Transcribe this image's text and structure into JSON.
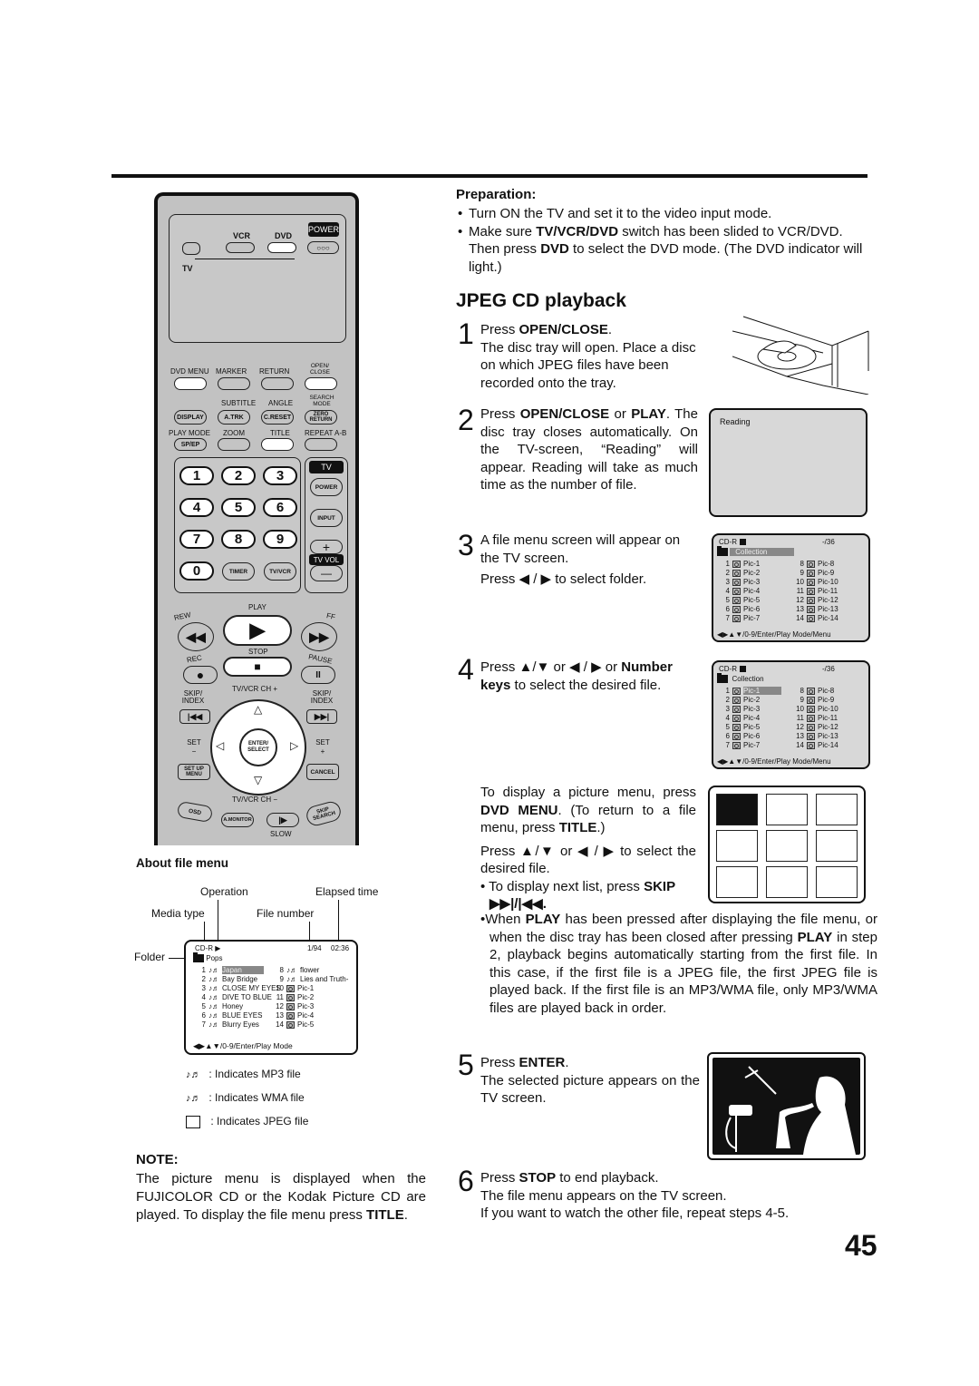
{
  "remote": {
    "vcr": "VCR",
    "dvd": "DVD",
    "power": "POWER",
    "tv_switch": "TV",
    "row1": [
      "DVD MENU",
      "MARKER",
      "RETURN",
      "OPEN/ CLOSE"
    ],
    "row2_labels": [
      "SUBTITLE",
      "ANGLE",
      "SEARCH MODE"
    ],
    "row2_buttons": [
      "DISPLAY",
      "A.TRK",
      "C.RESET",
      "ZERO RETURN"
    ],
    "row3_labels": [
      "PLAY MODE",
      "ZOOM",
      "TITLE",
      "REPEAT A-B"
    ],
    "row3_buttons": [
      "SP/EP"
    ],
    "numbers": [
      "1",
      "2",
      "3",
      "4",
      "5",
      "6",
      "7",
      "8",
      "9",
      "0"
    ],
    "timer": "TIMER",
    "tvvcr": "TV/VCR",
    "tv_badge": "TV",
    "tv_power": "POWER",
    "input": "INPUT",
    "vol_plus": "+",
    "vol_label": "TV VOL",
    "vol_minus": "—",
    "play": "PLAY",
    "rew": "REW",
    "ff": "FF",
    "rec": "REC",
    "stop": "STOP",
    "pause": "PAUSE",
    "ch_plus": "TV/VCR CH +",
    "ch_minus": "TV/VCR CH −",
    "skip_index_l": "SKIP/ INDEX",
    "skip_index_r": "SKIP/ INDEX",
    "set_minus": "SET −",
    "set_plus": "SET +",
    "enter": "ENTER/ SELECT",
    "setup_menu": "SET UP MENU",
    "cancel": "CANCEL",
    "osd": "OSD",
    "amonitor": "A.MONITOR",
    "skip_search": "SKIP SEARCH",
    "slow": "SLOW"
  },
  "about": {
    "heading": "About file menu",
    "labels": {
      "operation": "Operation",
      "elapsed": "Elapsed time",
      "media_type": "Media type",
      "file_number": "File number",
      "folder": "Folder"
    },
    "screen": {
      "media": "CD-R",
      "op": "▶",
      "file_no": "1/94",
      "time": "02:36",
      "folder": "Pops",
      "left": [
        {
          "n": "1",
          "name": "Japan",
          "type": "mp3",
          "selected": true
        },
        {
          "n": "2",
          "name": "Bay Bridge",
          "type": "mp3"
        },
        {
          "n": "3",
          "name": "CLOSE MY EYES",
          "type": "mp3"
        },
        {
          "n": "4",
          "name": "DIVE TO BLUE",
          "type": "mp3"
        },
        {
          "n": "5",
          "name": "Honey",
          "type": "mp3"
        },
        {
          "n": "6",
          "name": "BLUE EYES",
          "type": "mp3"
        },
        {
          "n": "7",
          "name": "Blurry Eyes",
          "type": "mp3"
        }
      ],
      "right": [
        {
          "n": "8",
          "name": "flower",
          "type": "mp3"
        },
        {
          "n": "9",
          "name": "Lies and Truth-",
          "type": "mp3"
        },
        {
          "n": "10",
          "name": "Pic-1",
          "type": "jpeg"
        },
        {
          "n": "11",
          "name": "Pic-2",
          "type": "jpeg"
        },
        {
          "n": "12",
          "name": "Pic-3",
          "type": "jpeg"
        },
        {
          "n": "13",
          "name": "Pic-4",
          "type": "jpeg"
        },
        {
          "n": "14",
          "name": "Pic-5",
          "type": "jpeg"
        }
      ],
      "footer": "◀▶▲▼/0-9/Enter/Play Mode"
    },
    "legend": [
      {
        "icon": "mp3-icon",
        "text": ": Indicates MP3 file"
      },
      {
        "icon": "wma-icon",
        "text": ": Indicates WMA file"
      },
      {
        "icon": "jpeg-icon",
        "text": ": Indicates JPEG file"
      }
    ]
  },
  "note": {
    "heading": "NOTE:",
    "text_a": "The picture menu is displayed when the FUJICOLOR CD or the Kodak Picture CD are played. To display the file menu press ",
    "text_b": "TITLE",
    "text_c": "."
  },
  "preparation": {
    "heading": "Preparation:",
    "b1": "Turn ON the TV and set it to the video input mode.",
    "b2_a": "Make sure ",
    "b2_b": "TV/VCR/DVD",
    "b2_c": " switch has been slided to VCR/DVD. Then press ",
    "b2_d": "DVD",
    "b2_e": " to select the DVD mode. (The DVD indicator will light.)"
  },
  "section_title": "JPEG CD playback",
  "steps": [
    {
      "num": "1",
      "l1a": "Press ",
      "l1b": "OPEN/CLOSE",
      "l1c": ".",
      "rest": "The disc tray will open. Place a disc on which JPEG files have been recorded onto the tray."
    },
    {
      "num": "2",
      "l1a": "Press ",
      "l1b": "OPEN/CLOSE",
      "l1c": " or ",
      "l1d": "PLAY",
      "l1e": ".",
      "rest": "The disc tray closes automatically. On the TV-screen, “Reading” will appear. Reading will take as much time as the number of file."
    },
    {
      "num": "3",
      "rest": "A file menu screen will appear on the TV screen.",
      "l2": "Press ◀ / ▶ to select folder."
    },
    {
      "num": "4",
      "l1a": "Press ▲/▼ or ◀ / ▶ or ",
      "l1b": "Number keys",
      "l1c": " to select the desired file."
    },
    {
      "num": "5",
      "l1a": "Press ",
      "l1b": "ENTER",
      "l1c": ".",
      "rest": "The selected picture appears on the TV screen."
    },
    {
      "num": "6",
      "l1a": "Press ",
      "l1b": "STOP",
      "l1c": " to end playback.",
      "rest": "The file menu appears on the TV screen.",
      "rest2": "If you want to watch the other file, repeat steps 4-5."
    }
  ],
  "picture_menu": {
    "p1a": "To display a picture menu, press ",
    "p1b": "DVD MENU",
    "p1c": ". (To return to a file menu, press ",
    "p1d": "TITLE",
    "p1e": ".)",
    "p2": "Press ▲/▼ or ◀ / ▶ to select the desired file.",
    "b1a": "• To display next list, press ",
    "b1b": "SKIP",
    "b1c": "▶▶|/|◀◀."
  },
  "play_note": {
    "a": "When ",
    "b": "PLAY",
    "c": " has been pressed after displaying the file menu, or when the disc tray has been closed after pressing ",
    "d": "PLAY",
    "e": " in step 2, playback begins automatically starting from the first file. In this case, if the first file is a JPEG file, the first JPEG file is played back. If the first file is an MP3/WMA file, only MP3/WMA files are played back in order."
  },
  "reading_screen": {
    "text": "Reading"
  },
  "collection_screen": {
    "media": "CD-R",
    "count": "-/36",
    "folder": "Collection",
    "left": [
      "Pic-1",
      "Pic-2",
      "Pic-3",
      "Pic-4",
      "Pic-5",
      "Pic-6",
      "Pic-7"
    ],
    "right": [
      "Pic-8",
      "Pic-9",
      "Pic-10",
      "Pic-11",
      "Pic-12",
      "Pic-13",
      "Pic-14"
    ],
    "footer": "◀▶▲▼/0-9/Enter/Play Mode/Menu"
  },
  "page_number": "45"
}
